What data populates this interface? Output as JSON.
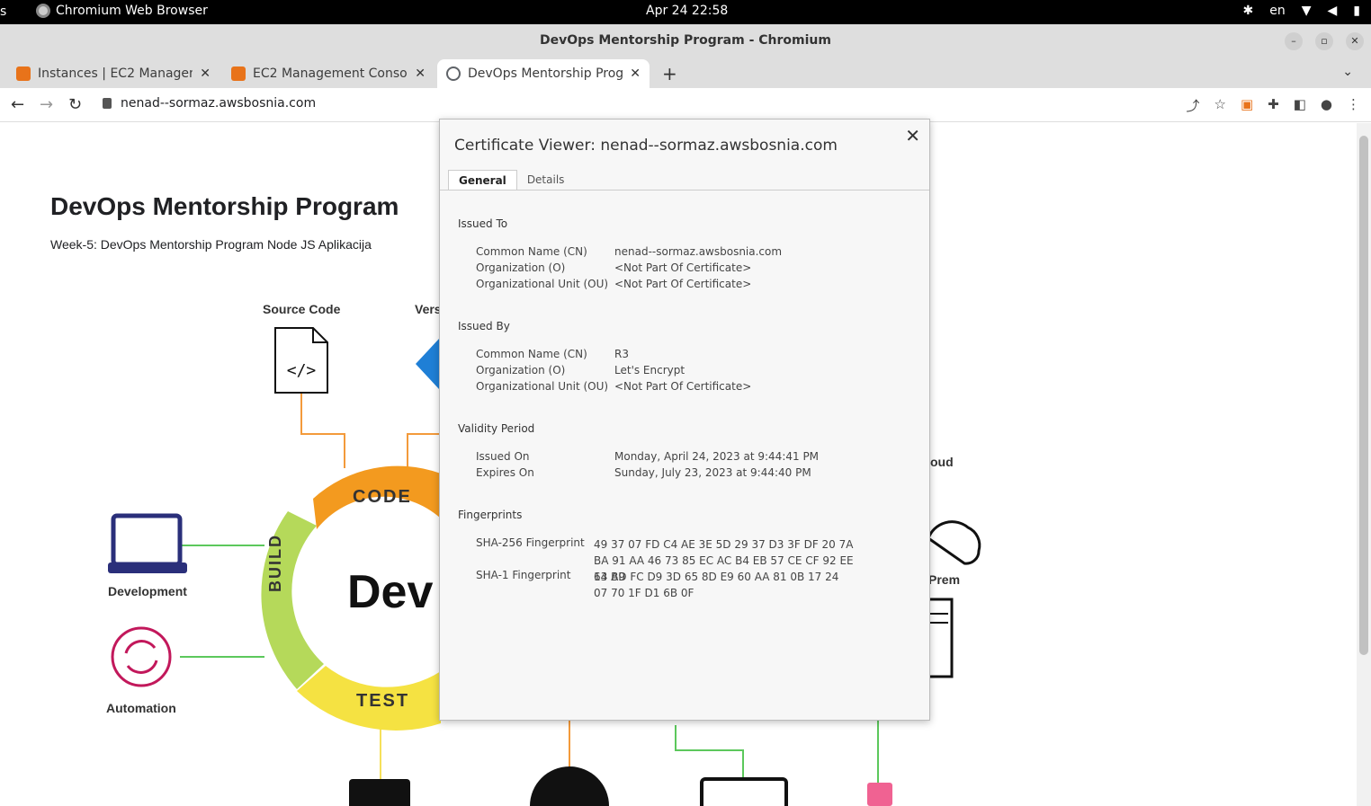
{
  "system": {
    "left_text": "s",
    "app_name": "Chromium Web Browser",
    "clock": "Apr 24  22:58",
    "lang": "en"
  },
  "window": {
    "title": "DevOps Mentorship Program - Chromium"
  },
  "tabs": [
    {
      "label": "Instances | EC2 Manageme"
    },
    {
      "label": "EC2 Management Console"
    },
    {
      "label": "DevOps Mentorship Prog"
    }
  ],
  "toolbar": {
    "url": "nenad--sormaz.awsbosnia.com"
  },
  "page": {
    "title": "DevOps Mentorship Program",
    "subtitle": "Week-5: DevOps Mentorship Program Node JS Aplikacija",
    "labels": {
      "source_code": "Source Code",
      "vers": "Vers",
      "development": "Development",
      "automation": "Automation",
      "cloud": "oud",
      "prem": "Prem",
      "dev": "Dev"
    },
    "cycle": {
      "code": "CODE",
      "build": "BUILD",
      "test": "TEST"
    }
  },
  "certificate": {
    "title": "Certificate Viewer: nenad--sormaz.awsbosnia.com",
    "tab_general": "General",
    "tab_details": "Details",
    "issued_to": {
      "heading": "Issued To",
      "rows": [
        {
          "k": "Common Name (CN)",
          "v": "nenad--sormaz.awsbosnia.com"
        },
        {
          "k": "Organization (O)",
          "v": "<Not Part Of Certificate>"
        },
        {
          "k": "Organizational Unit (OU)",
          "v": "<Not Part Of Certificate>"
        }
      ]
    },
    "issued_by": {
      "heading": "Issued By",
      "rows": [
        {
          "k": "Common Name (CN)",
          "v": "R3"
        },
        {
          "k": "Organization (O)",
          "v": "Let's Encrypt"
        },
        {
          "k": "Organizational Unit (OU)",
          "v": "<Not Part Of Certificate>"
        }
      ]
    },
    "validity": {
      "heading": "Validity Period",
      "rows": [
        {
          "k": "Issued On",
          "v": "Monday, April 24, 2023 at 9:44:41 PM"
        },
        {
          "k": "Expires On",
          "v": "Sunday, July 23, 2023 at 9:44:40 PM"
        }
      ]
    },
    "fingerprints": {
      "heading": "Fingerprints",
      "sha256_label": "SHA-256 Fingerprint",
      "sha256_value": "49 37 07 FD C4 AE 3E 5D 29 37 D3 3F DF 20 7A BA 91 AA 46 73 85 EC AC B4 EB 57 CE CF 92 EE 64 B9",
      "sha1_label": "SHA-1 Fingerprint",
      "sha1_value": "13 AD FC D9 3D 65 8D E9 60 AA 81 0B 17 24 07 70 1F D1 6B 0F"
    }
  }
}
